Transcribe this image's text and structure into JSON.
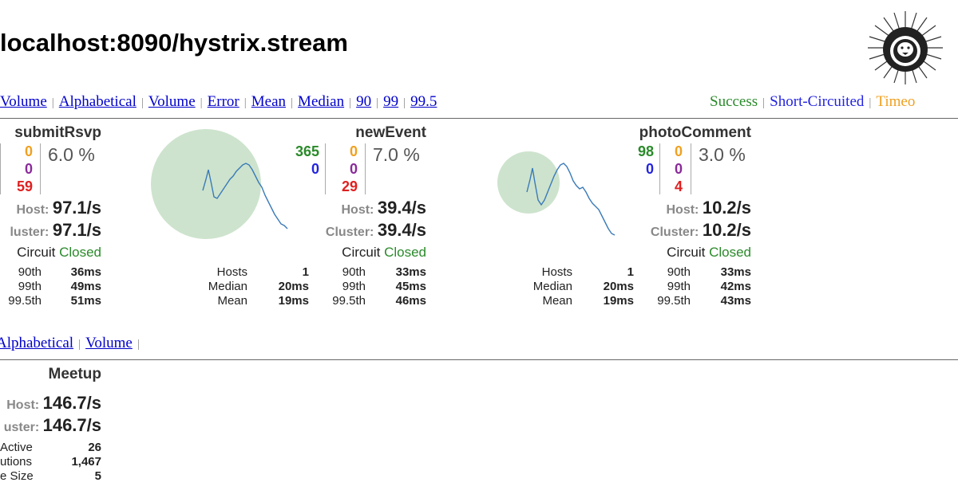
{
  "title": "localhost:8090/hystrix.stream",
  "commands_sortbar": {
    "items": [
      "Volume",
      "Alphabetical",
      "Volume",
      "Error",
      "Mean",
      "Median",
      "90",
      "99",
      "99.5"
    ]
  },
  "legend": {
    "success": "Success",
    "short_circuited": "Short-Circuited",
    "timeout": "Timeo"
  },
  "colors": {
    "success": "#2a8a2a",
    "short_circuited": "#2424e0",
    "timeout": "#f0a020",
    "rejected": "#8a2a9a",
    "failure": "#e02020",
    "circle": "#cde3cd",
    "sparkline": "#3a7ab8"
  },
  "commands": [
    {
      "name": "submitRsvp",
      "success": "",
      "short_circuited": "",
      "timeout": "0",
      "rejected": "0",
      "failure": "59",
      "error_pct": "6.0 %",
      "host_label": "Host:",
      "host_rate": "97.1/s",
      "cluster_label": "luster:",
      "cluster_rate": "97.1/s",
      "circuit_label": "Circuit",
      "circuit_status": "Closed",
      "p90_label": "90th",
      "p90": "36ms",
      "p99_label": "99th",
      "p99": "49ms",
      "p995_label": "99.5th",
      "p995": "51ms"
    },
    {
      "name": "newEvent",
      "success": "365",
      "short_circuited": "0",
      "timeout": "0",
      "rejected": "0",
      "failure": "29",
      "error_pct": "7.0 %",
      "host_label": "Host:",
      "host_rate": "39.4/s",
      "cluster_label": "Cluster:",
      "cluster_rate": "39.4/s",
      "circuit_label": "Circuit",
      "circuit_status": "Closed",
      "hosts_label": "Hosts",
      "hosts": "1",
      "median_label": "Median",
      "median": "20ms",
      "mean_label": "Mean",
      "mean": "19ms",
      "p90_label": "90th",
      "p90": "33ms",
      "p99_label": "99th",
      "p99": "45ms",
      "p995_label": "99.5th",
      "p995": "46ms"
    },
    {
      "name": "photoComment",
      "success": "98",
      "short_circuited": "0",
      "timeout": "0",
      "rejected": "0",
      "failure": "4",
      "error_pct": "3.0 %",
      "host_label": "Host:",
      "host_rate": "10.2/s",
      "cluster_label": "Cluster:",
      "cluster_rate": "10.2/s",
      "circuit_label": "Circuit",
      "circuit_status": "Closed",
      "hosts_label": "Hosts",
      "hosts": "1",
      "median_label": "Median",
      "median": "20ms",
      "mean_label": "Mean",
      "mean": "19ms",
      "p90_label": "90th",
      "p90": "33ms",
      "p99_label": "99th",
      "p99": "42ms",
      "p995_label": "99.5th",
      "p995": "43ms"
    }
  ],
  "pools_sortbar": {
    "items": [
      "Alphabetical",
      "Volume"
    ]
  },
  "pool": {
    "name": "Meetup",
    "host_label": "Host:",
    "host_rate": "146.7/s",
    "cluster_label": "uster:",
    "cluster_rate": "146.7/s",
    "active_label": "Active",
    "active": "26",
    "executions_label": "utions",
    "executions": "1,467",
    "queue_label": "e Size",
    "queue": "5"
  }
}
